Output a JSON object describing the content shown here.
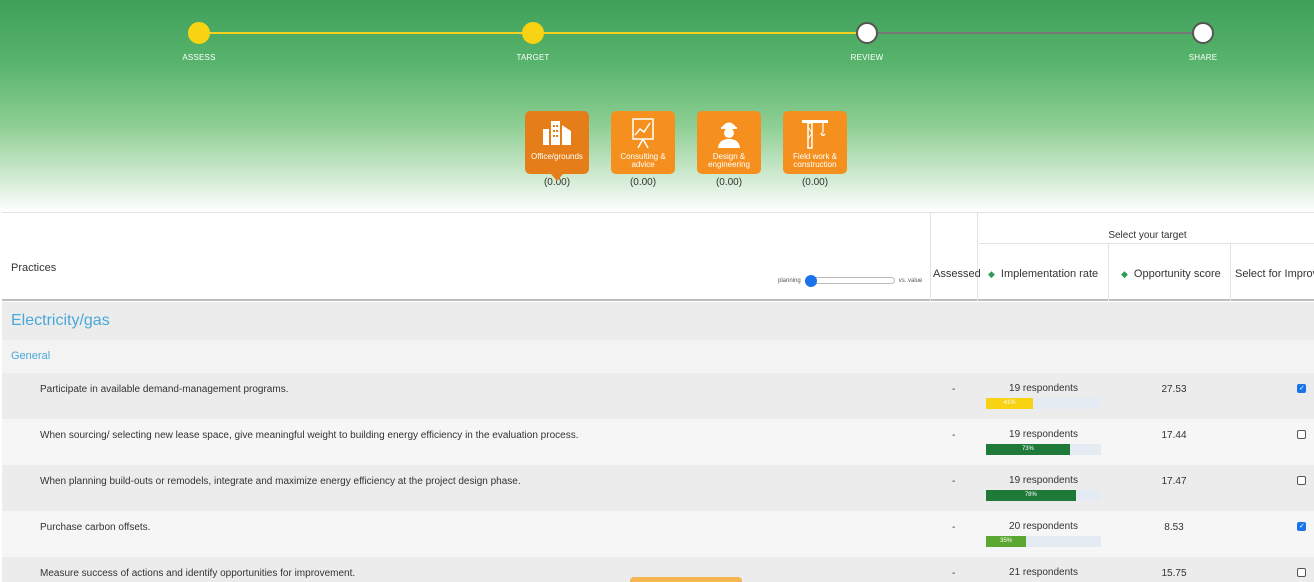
{
  "steps": [
    {
      "label": "ASSESS",
      "state": "done"
    },
    {
      "label": "TARGET",
      "state": "done"
    },
    {
      "label": "REVIEW",
      "state": "todo"
    },
    {
      "label": "SHARE",
      "state": "todo"
    }
  ],
  "categories": [
    {
      "label": "Office/grounds",
      "score": "(0.00)",
      "icon": "office-building-icon",
      "active": true
    },
    {
      "label": "Consulting & advice",
      "score": "(0.00)",
      "icon": "presentation-chart-icon"
    },
    {
      "label": "Design & engineering",
      "score": "(0.00)",
      "icon": "engineer-icon"
    },
    {
      "label": "Field work & construction",
      "score": "(0.00)",
      "icon": "crane-icon"
    }
  ],
  "table": {
    "practices_label": "Practices",
    "slider_left": "planning",
    "slider_right": "vs. value",
    "assessed_label": "Assessed",
    "target_label": "Select your target",
    "impl_label": "Implementation rate",
    "opp_label": "Opportunity score",
    "select_label": "Select for Improv"
  },
  "group": "Electricity/gas",
  "subgroup": "General",
  "rows": [
    {
      "text": "Participate in available demand-management programs.",
      "assessed": "-",
      "respondents": "19 respondents",
      "pct": "41%",
      "pct_value": 41,
      "bar_color": "#f7d313",
      "opp": "27.53",
      "checked": true
    },
    {
      "text": "When sourcing/ selecting new lease space, give meaningful weight to building energy efficiency in the evaluation process.",
      "assessed": "-",
      "respondents": "19 respondents",
      "pct": "73%",
      "pct_value": 73,
      "bar_color": "#1f7a3a",
      "opp": "17.44",
      "checked": false
    },
    {
      "text": "When planning build-outs or remodels, integrate and maximize energy efficiency at the project design phase.",
      "assessed": "-",
      "respondents": "19 respondents",
      "pct": "78%",
      "pct_value": 78,
      "bar_color": "#1f7a3a",
      "opp": "17.47",
      "checked": false
    },
    {
      "text": "Purchase carbon offsets.",
      "assessed": "-",
      "respondents": "20 respondents",
      "pct": "35%",
      "pct_value": 35,
      "bar_color": "#5aa832",
      "opp": "8.53",
      "checked": true
    },
    {
      "text": "Measure success of actions and identify opportunities for improvement.",
      "assessed": "-",
      "respondents": "21 respondents",
      "pct": "",
      "pct_value": 0,
      "bar_color": "#1f7a3a",
      "opp": "15.75",
      "checked": false
    }
  ]
}
